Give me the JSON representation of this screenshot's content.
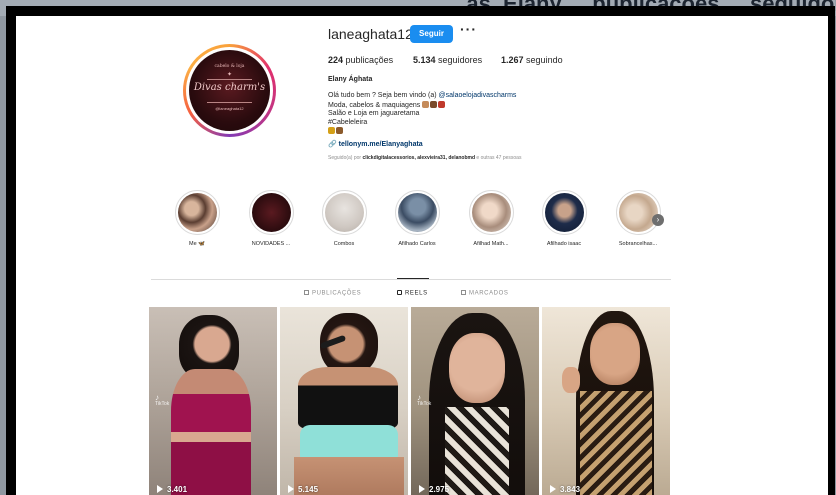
{
  "banner": {
    "partial_text": "...as, Elany ... publicações ... seguidores ... seguindo ... Elany Aghata"
  },
  "profile": {
    "username": "laneaghata12",
    "follow_label": "Seguir",
    "more_label": "···",
    "stats": [
      {
        "value": "224",
        "label": "publicações"
      },
      {
        "value": "5.134",
        "label": "seguidores"
      },
      {
        "value": "1.267",
        "label": "seguindo"
      }
    ],
    "full_name": "Elany Ághata",
    "bio": {
      "line1_prefix": "Olá tudo bem ? Seja bem vindo (a) ",
      "line1_mention": "@salaoelojadivascharms",
      "line2": "Moda, cabelos & maquiagens",
      "line3": "Salão e Loja em jaguaretama",
      "line4": "#Cabeleleira"
    },
    "link": "tellonym.me/Elanyaghata",
    "followed_by_prefix": "Seguido(a) por ",
    "followed_by_names": "clickdigitalacessorios, alexvieira31, delanobmd",
    "followed_by_suffix": " e outras 47 pessoas"
  },
  "avatar": {
    "tagline": "cabelo & loja",
    "brand": "Divas charm's",
    "handle": "@laneaghata12"
  },
  "highlights": [
    {
      "label": "Me 🦋"
    },
    {
      "label": "NOVIDADES ..."
    },
    {
      "label": "Combos"
    },
    {
      "label": "Afilhado Carlos"
    },
    {
      "label": "Afilhad Math..."
    },
    {
      "label": "Afilhado isaac"
    },
    {
      "label": "Sobrancelhas..."
    }
  ],
  "tabs": [
    {
      "label": "PUBLICAÇÕES",
      "active": false
    },
    {
      "label": "REELS",
      "active": true
    },
    {
      "label": "MARCADOS",
      "active": false
    }
  ],
  "reels": [
    {
      "views": "3.401",
      "tiktok": true
    },
    {
      "views": "5.145",
      "tiktok": false
    },
    {
      "views": "2.975",
      "tiktok": true
    },
    {
      "views": "3.843",
      "tiktok": false
    }
  ],
  "tiktok_label": "TikTok",
  "colors": {
    "follow_button": "#1a8df0",
    "link": "#00376b",
    "muted": "#8e8e8e"
  }
}
